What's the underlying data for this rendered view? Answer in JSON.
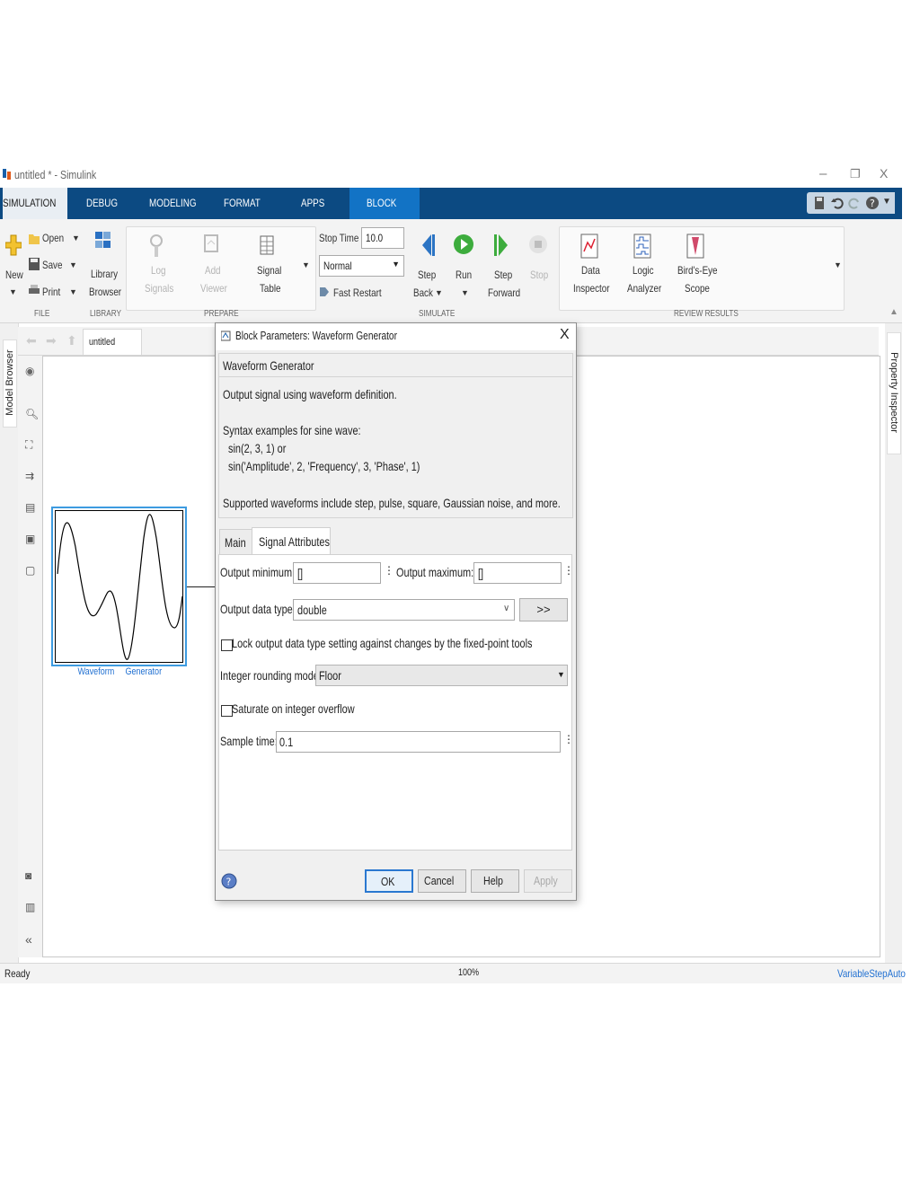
{
  "window": {
    "title": "untitled * - Simulink",
    "minimize": "–",
    "restore": "❐",
    "close": "X"
  },
  "tabs": [
    "SIMULATION",
    "DEBUG",
    "MODELING",
    "FORMAT",
    "APPS",
    "BLOCK"
  ],
  "toolstrip": {
    "file": {
      "section": "FILE",
      "new": "New",
      "open": "Open",
      "save": "Save",
      "print": "Print"
    },
    "library": {
      "section": "LIBRARY",
      "label1": "Library",
      "label2": "Browser"
    },
    "prepare": {
      "section": "PREPARE",
      "log1": "Log",
      "log2": "Signals",
      "add1": "Add",
      "add2": "Viewer",
      "sig1": "Signal",
      "sig2": "Table"
    },
    "simulate": {
      "section": "SIMULATE",
      "stop_time_label": "Stop Time",
      "stop_time_value": "10.0",
      "mode_value": "Normal",
      "fast_restart": "Fast Restart",
      "step_back1": "Step",
      "step_back2": "Back",
      "run": "Run",
      "step_fwd1": "Step",
      "step_fwd2": "Forward",
      "stop": "Stop"
    },
    "review": {
      "section": "REVIEW RESULTS",
      "data1": "Data",
      "data2": "Inspector",
      "logic1": "Logic",
      "logic2": "Analyzer",
      "bird1": "Bird's-Eye",
      "bird2": "Scope"
    }
  },
  "editor": {
    "left_panel": "Model Browser",
    "right_panel": "Property Inspector",
    "breadcrumb": "untitled",
    "block_label1": "Waveform",
    "block_label2": "Generator"
  },
  "status": {
    "left": "Ready",
    "zoom": "100%",
    "solver": "VariableStepAuto"
  },
  "dialog": {
    "title": "Block Parameters: Waveform Generator",
    "close": "X",
    "block_name": "Waveform Generator",
    "desc1": "Output signal using waveform definition.",
    "desc2": "Syntax examples for sine wave:",
    "desc3": "sin(2, 3, 1) or",
    "desc4": "sin('Amplitude', 2, 'Frequency', 3, 'Phase', 1)",
    "desc5": "Supported waveforms include step, pulse, square, Gaussian noise, and more.",
    "tab_main": "Main",
    "tab_signal": "Signal Attributes",
    "out_min_label": "Output minimum:",
    "out_min_value": "[]",
    "out_max_label": "Output maximum:",
    "out_max_value": "[]",
    "dtype_label": "Output data type:",
    "dtype_value": "double",
    "dtype_btn": ">>",
    "lock_label": "Lock output data type setting against changes by the fixed-point tools",
    "lock_checked": false,
    "rounding_label": "Integer rounding mode:",
    "rounding_value": "Floor",
    "saturate_label": "Saturate on integer overflow",
    "saturate_checked": false,
    "sample_label": "Sample time:",
    "sample_value": "0.1",
    "ok": "OK",
    "cancel": "Cancel",
    "help": "Help",
    "apply": "Apply"
  },
  "colors": {
    "ribbon": "#0c4a82",
    "active_tab": "#1273c5",
    "block_select": "#3d9be0",
    "link": "#1f6fd1"
  }
}
